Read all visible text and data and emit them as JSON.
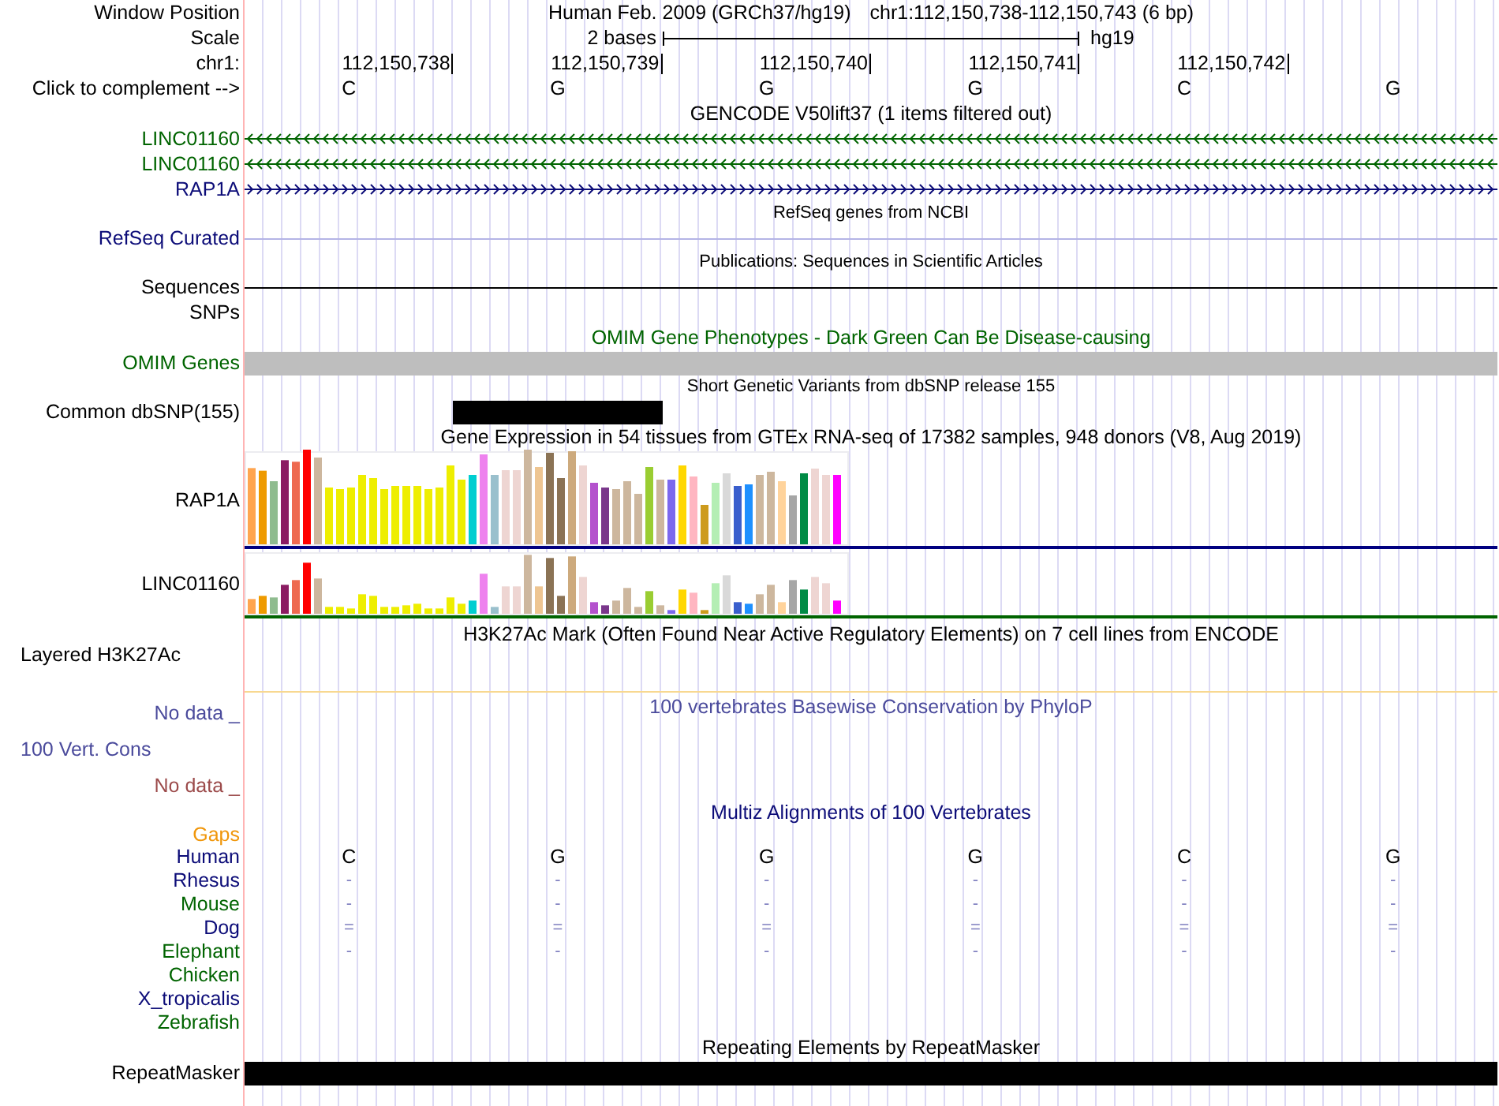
{
  "header": {
    "label": "Window Position",
    "assembly": "Human Feb. 2009 (GRCh37/hg19)",
    "position": "chr1:112,150,738-112,150,743 (6 bp)"
  },
  "scale": {
    "label": "Scale",
    "text": "2 bases",
    "assembly": "hg19"
  },
  "ruler": {
    "label": "chr1:",
    "positions": [
      "112,150,738",
      "112,150,739",
      "112,150,740",
      "112,150,741",
      "112,150,742"
    ]
  },
  "bases": {
    "label": "Click to complement -->",
    "letters": [
      "C",
      "G",
      "G",
      "G",
      "C",
      "G"
    ]
  },
  "tracks": [
    {
      "kind": "title",
      "text": "GENCODE V50lift37 (1 items filtered out)",
      "color": "#000000"
    },
    {
      "kind": "gene",
      "label": "LINC01160",
      "reverse_strand": true,
      "color": "#006400"
    },
    {
      "kind": "gene",
      "label": "LINC01160",
      "reverse_strand": true,
      "color": "#006400"
    },
    {
      "kind": "gene",
      "label": "RAP1A",
      "reverse_strand": false,
      "color": "#0c0c78"
    },
    {
      "kind": "note",
      "text": "RefSeq genes from NCBI"
    },
    {
      "kind": "line",
      "label": "RefSeq Curated",
      "color": "#0c0c78",
      "line": {
        "color": "#b4b4e6"
      }
    },
    {
      "kind": "note",
      "text": "Publications: Sequences in Scientific Articles"
    },
    {
      "kind": "line",
      "label": "Sequences",
      "color": "#000000",
      "line": {
        "color": "#000000"
      }
    },
    {
      "kind": "empty",
      "label": "SNPs",
      "color": "#000000"
    },
    {
      "kind": "title",
      "text": "OMIM Gene Phenotypes - Dark Green Can Be Disease-causing",
      "color": "#006400"
    },
    {
      "kind": "block",
      "label": "OMIM Genes",
      "color": "#006400",
      "bar": {
        "color": "#bebebe"
      }
    },
    {
      "kind": "note",
      "text": "Short Genetic Variants from dbSNP release 155"
    },
    {
      "kind": "snp",
      "label": "Common dbSNP(155)",
      "color": "#000000"
    },
    {
      "kind": "title",
      "text": "Gene Expression in 54 tissues from GTEx RNA-seq of 17382 samples, 948 donors (V8, Aug 2019)",
      "color": "#000000"
    },
    {
      "kind": "expression",
      "label": "RAP1A",
      "color": "#000000",
      "baseline": {
        "color": "#000080"
      }
    },
    {
      "kind": "expression",
      "label": "LINC01160",
      "color": "#000000",
      "baseline": {
        "color": "#006400"
      }
    },
    {
      "kind": "layered",
      "label": "Layered H3K27Ac",
      "color": "#000000",
      "title": "H3K27Ac Mark (Often Found Near Active Regulatory Elements) on 7 cell lines from ENCODE"
    },
    {
      "kind": "conservation",
      "labels": [
        {
          "text": "No data _",
          "color": "#4b4b9c"
        },
        {
          "text": "100 Vert. Cons",
          "color": "#4b4b9c"
        },
        {
          "text": "No data _",
          "color": "#9c4b4b"
        }
      ],
      "title": "100 vertebrates Basewise Conservation by PhyloP",
      "color": "#4b4b9c"
    },
    {
      "kind": "title",
      "text": "Multiz Alignments of 100 Vertebrates",
      "color": "#0c0c78"
    },
    {
      "kind": "gaps",
      "label": "Gaps",
      "color": "#f0960a"
    },
    {
      "kind": "species",
      "label": "Human",
      "color": "#0c0c78",
      "bases": [
        "C",
        "G",
        "G",
        "G",
        "C",
        "G"
      ]
    },
    {
      "kind": "species",
      "label": "Rhesus",
      "color": "#0c0c78",
      "bases": [
        "-",
        "-",
        "-",
        "-",
        "-",
        "-"
      ]
    },
    {
      "kind": "species",
      "label": "Mouse",
      "color": "#006400",
      "bases": [
        "-",
        "-",
        "-",
        "-",
        "-",
        "-"
      ]
    },
    {
      "kind": "species",
      "label": "Dog",
      "color": "#0c0c78",
      "bases": [
        "=",
        "=",
        "=",
        "=",
        "=",
        "="
      ]
    },
    {
      "kind": "species",
      "label": "Elephant",
      "color": "#006400",
      "bases": [
        "-",
        "-",
        "-",
        "-",
        "-",
        "-"
      ]
    },
    {
      "kind": "species",
      "label": "Chicken",
      "color": "#006400"
    },
    {
      "kind": "species",
      "label": "X_tropicalis",
      "color": "#0c0c78"
    },
    {
      "kind": "species",
      "label": "Zebrafish",
      "color": "#006400"
    },
    {
      "kind": "title",
      "text": "Repeating Elements by RepeatMasker",
      "color": "#000000"
    },
    {
      "kind": "block",
      "label": "RepeatMasker",
      "color": "#000000",
      "bar": {
        "color": "#000000"
      }
    }
  ]
}
